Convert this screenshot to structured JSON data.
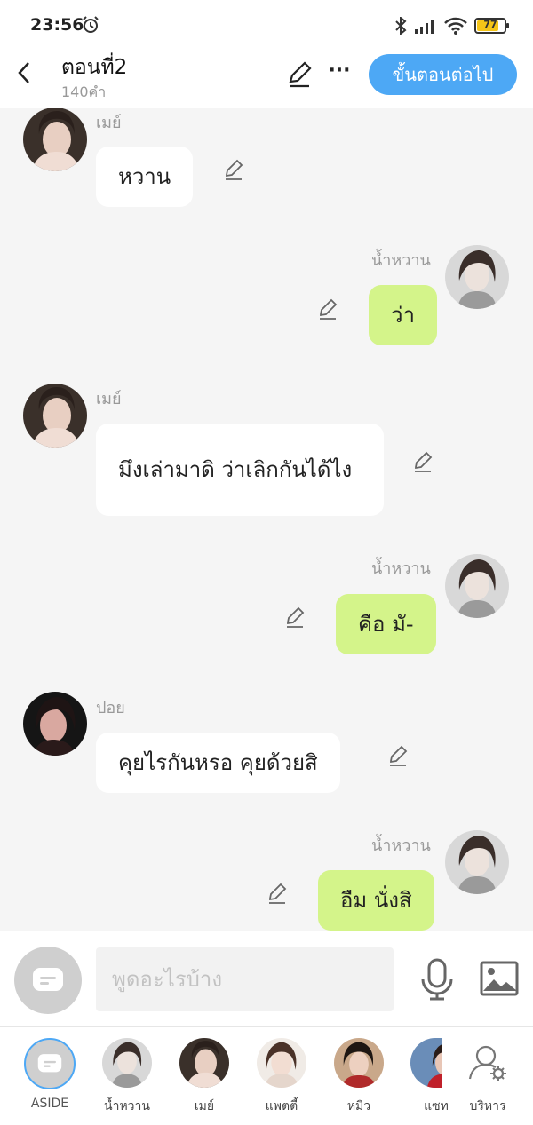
{
  "status": {
    "time": "23:56",
    "battery": "77"
  },
  "header": {
    "title": "ตอนที่2",
    "word_count": "140คำ",
    "next_label": "ขั้นตอนต่อไป",
    "more": "···"
  },
  "messages": [
    {
      "side": "left",
      "sender": "เมย์",
      "text": "หวาน"
    },
    {
      "side": "right",
      "sender": "น้ำหวาน",
      "text": "ว่า"
    },
    {
      "side": "left",
      "sender": "เมย์",
      "text": "มึงเล่ามาดิ ว่าเลิกกันได้ไง"
    },
    {
      "side": "right",
      "sender": "น้ำหวาน",
      "text": "คือ มั-"
    },
    {
      "side": "left",
      "sender": "ปอย",
      "text": "คุยไรกันหรอ คุยด้วยสิ"
    },
    {
      "side": "right",
      "sender": "น้ำหวาน",
      "text": "อืม นั่งสิ"
    }
  ],
  "input": {
    "placeholder": "พูดอะไรบ้าง"
  },
  "characters": [
    {
      "label": "ASIDE"
    },
    {
      "label": "น้ำหวาน"
    },
    {
      "label": "เมย์"
    },
    {
      "label": "แพตตี้"
    },
    {
      "label": "หมิว"
    },
    {
      "label": "แซท"
    },
    {
      "label": "บริหาร"
    }
  ],
  "colors": {
    "accent": "#4da8f5",
    "right_bubble": "#d4f48a",
    "left_bubble": "#ffffff",
    "background": "#f5f5f5"
  },
  "icons": [
    "alarm-icon",
    "bluetooth-icon",
    "signal-icon",
    "wifi-icon",
    "battery-icon",
    "back-arrow-icon",
    "pen-icon",
    "more-icon",
    "chat-bubble-icon",
    "mic-icon",
    "image-icon",
    "manage-user-icon"
  ]
}
